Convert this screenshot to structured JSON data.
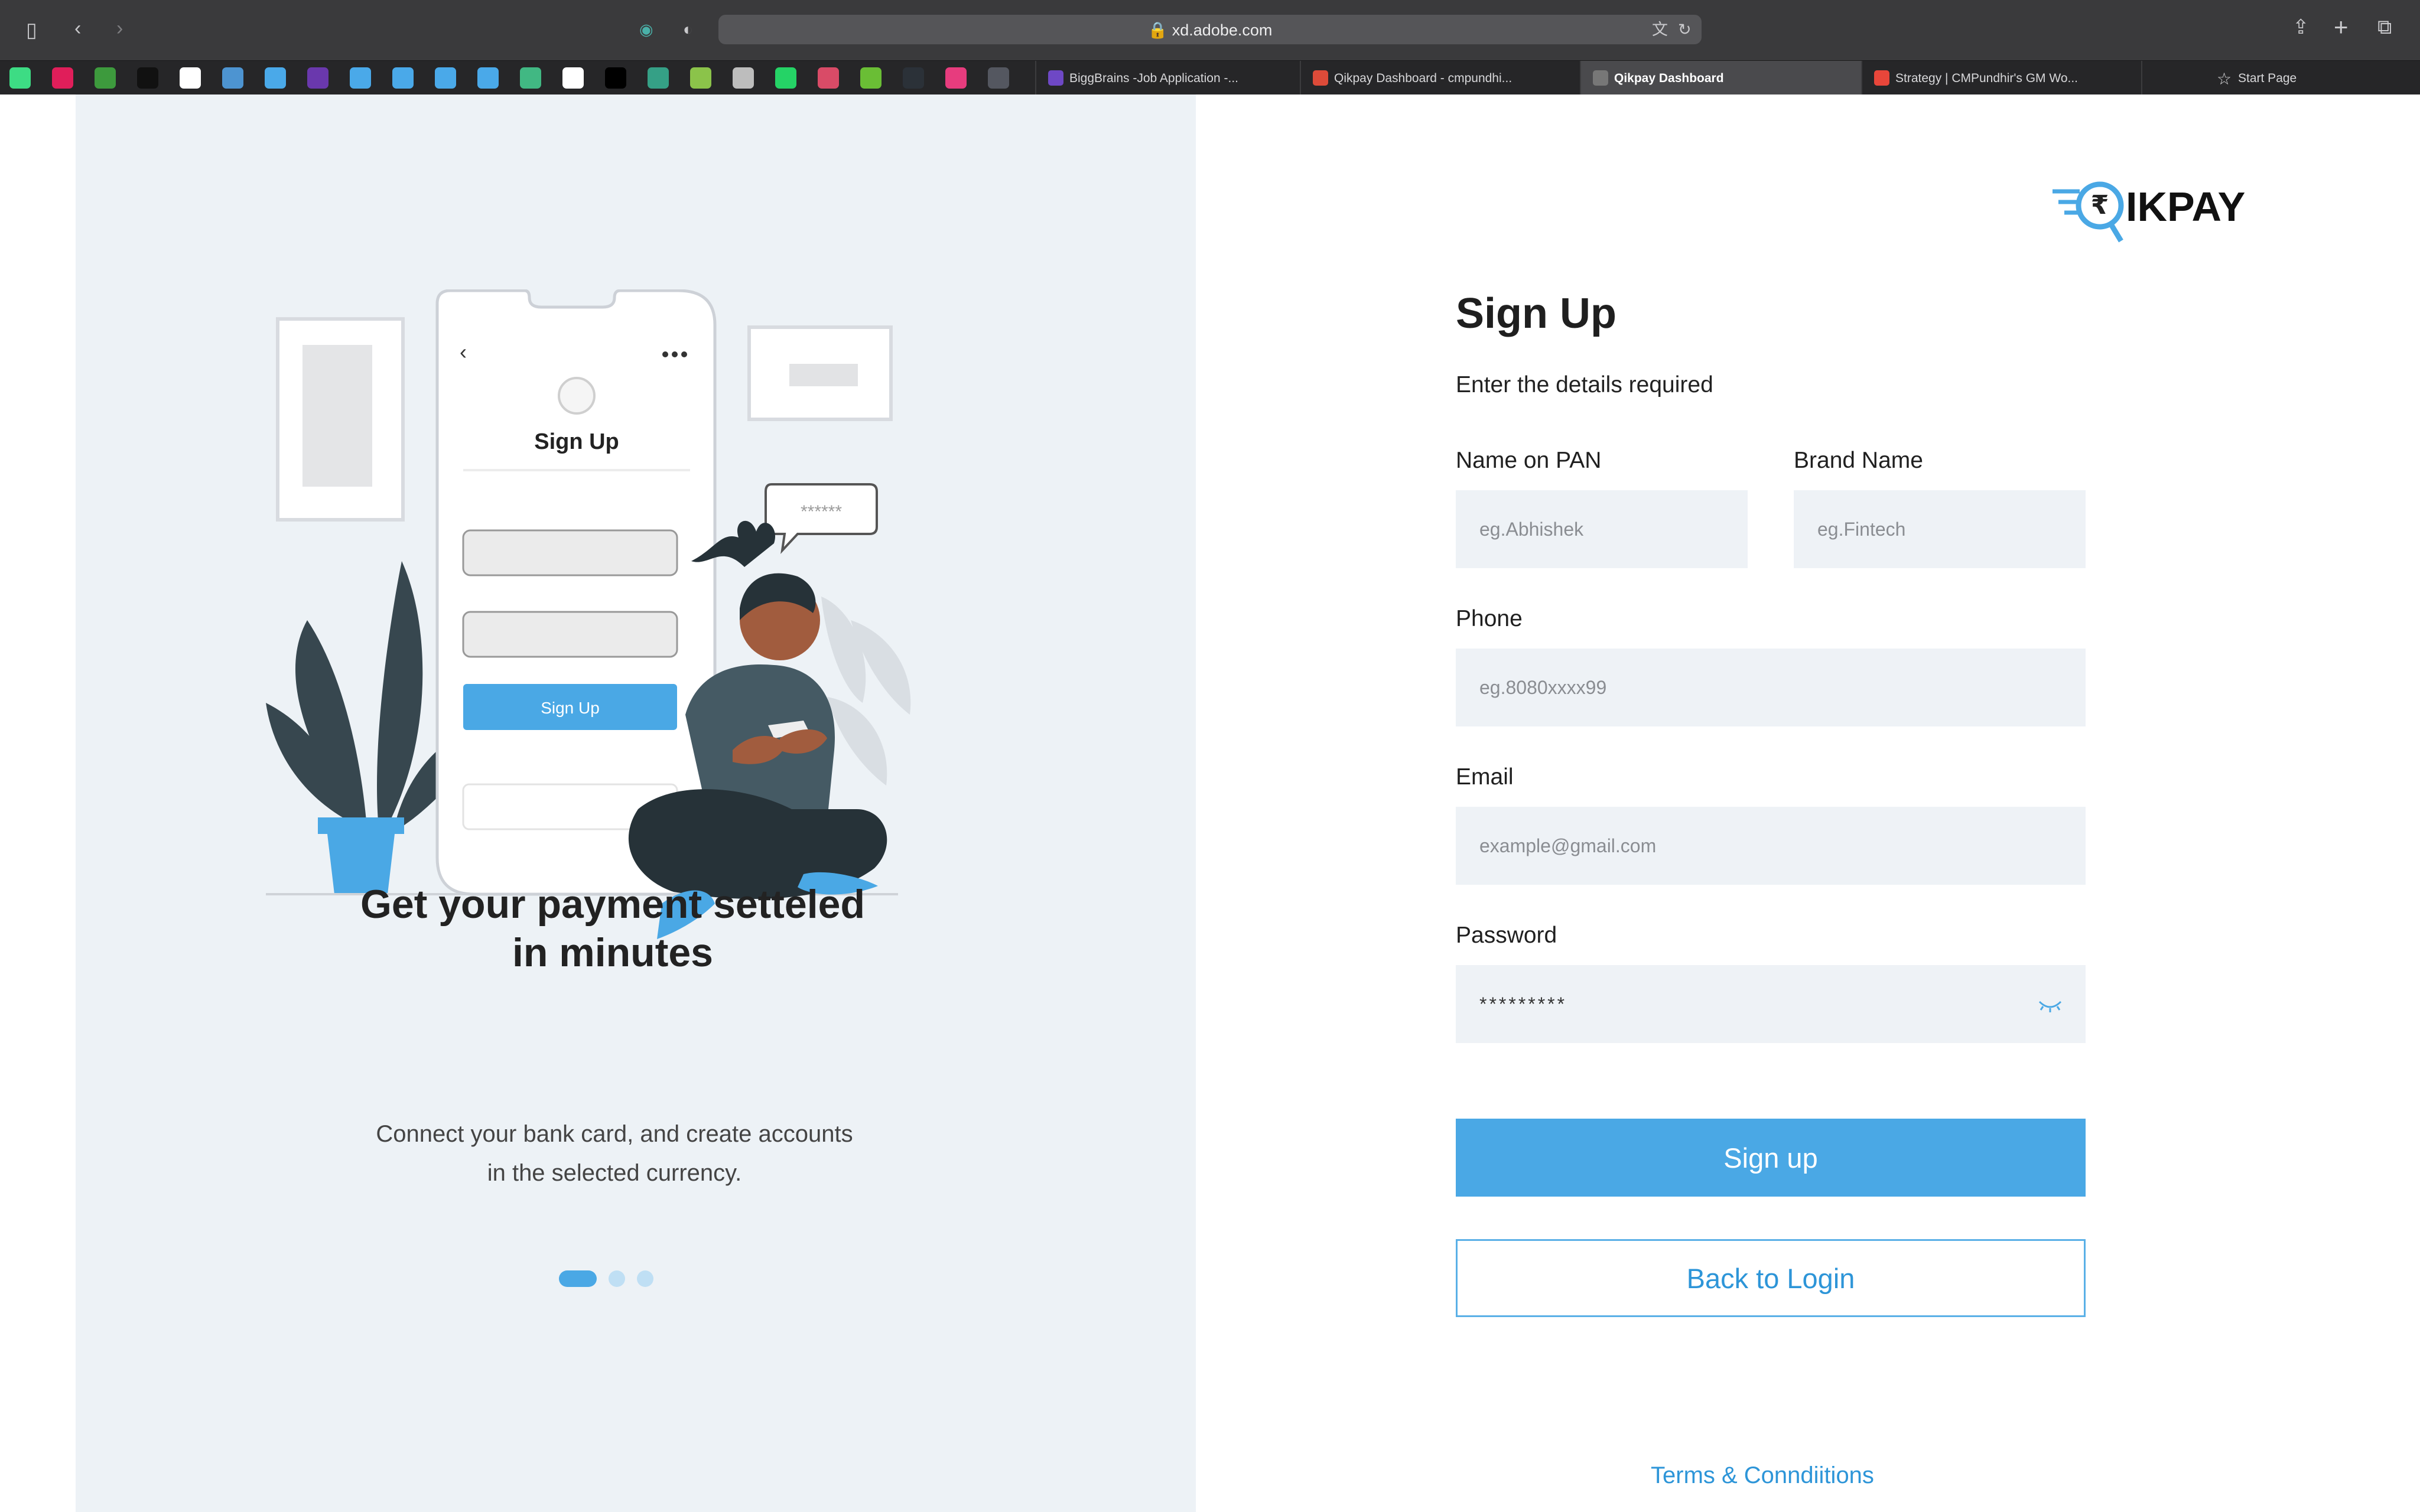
{
  "browser": {
    "url": "xd.adobe.com",
    "tabs": [
      {
        "label": "BiggBrains -Job Application -..."
      },
      {
        "label": "Qikpay Dashboard - cmpundhi..."
      },
      {
        "label": "Qikpay Dashboard"
      },
      {
        "label": "Strategy | CMPundhir's GM Wo..."
      },
      {
        "label": "Start Page"
      }
    ]
  },
  "illustration": {
    "phone_title": "Sign Up",
    "phone_button": "Sign Up",
    "password_bubble": "******"
  },
  "carousel": {
    "headline_line1": "Get your payment setteled",
    "headline_line2": "in minutes",
    "description_line1": "Connect your bank card, and create accounts",
    "description_line2": "in the selected currency."
  },
  "brand": {
    "logo_text": "IKPAY",
    "currency_symbol": "₹"
  },
  "form": {
    "title": "Sign Up",
    "subtitle": "Enter the details required",
    "name_label": "Name on PAN",
    "name_placeholder": "eg.Abhishek",
    "brand_label": "Brand Name",
    "brand_placeholder": "eg.Fintech",
    "phone_label": "Phone",
    "phone_placeholder": "eg.8080xxxx99",
    "email_label": "Email",
    "email_placeholder": "example@gmail.com",
    "password_label": "Password",
    "password_value": "*********",
    "signup_button": "Sign up",
    "back_button": "Back to Login",
    "terms_link": "Terms & Conndiitions"
  },
  "colors": {
    "accent": "#4aa8e5",
    "panel": "#edf2f6",
    "field": "#eef2f6"
  }
}
